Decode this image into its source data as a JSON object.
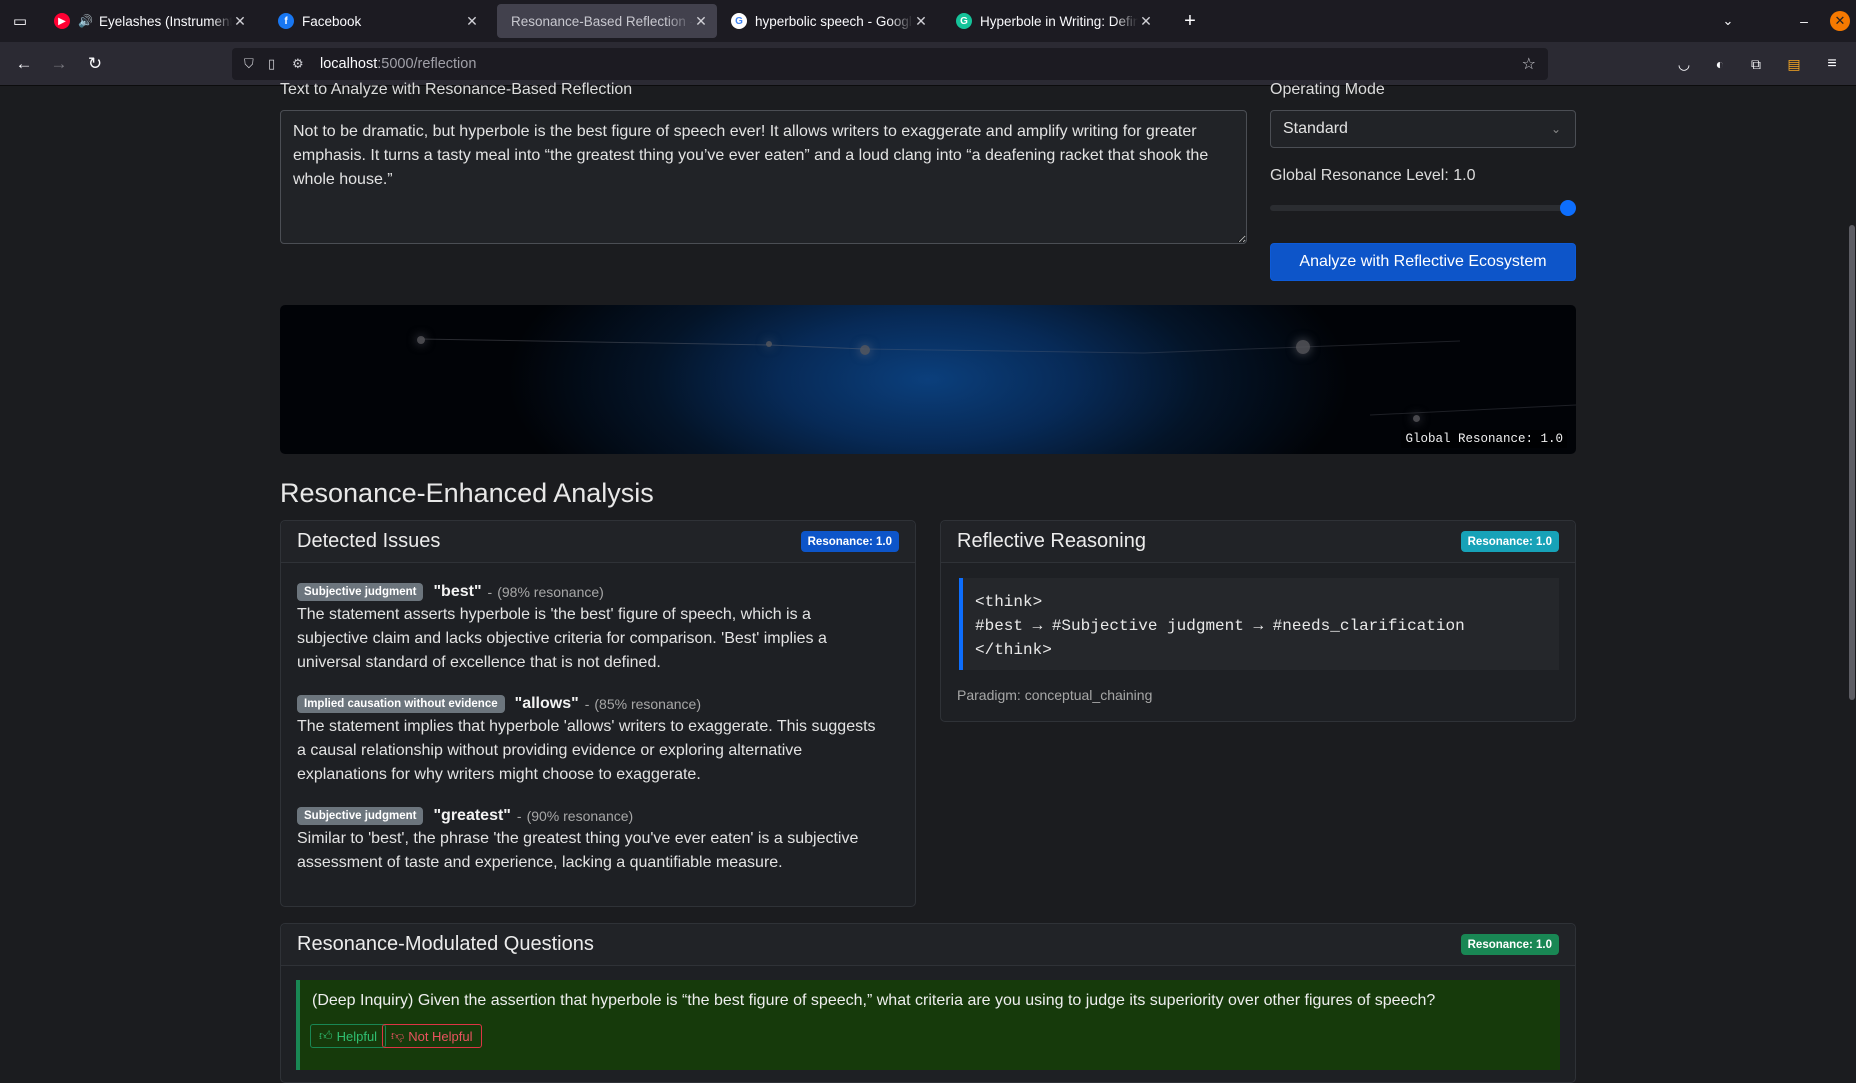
{
  "browser": {
    "tabs": [
      {
        "title": "Eyelashes (Instrumental) - A",
        "favicon": "youtube-music-icon",
        "audio": true,
        "active": false
      },
      {
        "title": "Facebook",
        "favicon": "facebook-icon",
        "active": false
      },
      {
        "title": "Resonance-Based Reflection - A",
        "favicon": "",
        "active": true
      },
      {
        "title": "hyperbolic speech - Google Se",
        "favicon": "google-icon",
        "active": false
      },
      {
        "title": "Hyperbole in Writing: Definitio",
        "favicon": "grammarly-icon",
        "active": false
      }
    ],
    "url_host": "localhost",
    "url_rest": ":5000/reflection"
  },
  "form": {
    "text_label": "Text to Analyze with Resonance-Based Reflection",
    "text_value": "Not to be dramatic, but hyperbole is the best figure of speech ever! It allows writers to exaggerate and amplify writing for greater emphasis. It turns a tasty meal into “the greatest thing you’ve ever eaten” and a loud clang into “a deafening racket that shook the whole house.”",
    "mode_label": "Operating Mode",
    "mode_value": "Standard",
    "resonance_label": "Global Resonance Level: 1.0",
    "resonance_level": 1.0,
    "analyze_button": "Analyze with Reflective Ecosystem"
  },
  "visualization": {
    "label": "Global Resonance: 1.0"
  },
  "analysis": {
    "heading": "Resonance-Enhanced Analysis",
    "issues": {
      "title": "Detected Issues",
      "badge": "Resonance: 1.0",
      "badge_color": "#0d55c9",
      "items": [
        {
          "category": "Subjective judgment",
          "term": "\"best\"",
          "sep": "-",
          "resonance": "(98% resonance)",
          "text": "The statement asserts hyperbole is 'the best' figure of speech, which is a subjective claim and lacks objective criteria for comparison. 'Best' implies a universal standard of excellence that is not defined."
        },
        {
          "category": "Implied causation without evidence",
          "term": "\"allows\"",
          "sep": "-",
          "resonance": "(85% resonance)",
          "text": "The statement implies that hyperbole 'allows' writers to exaggerate. This suggests a causal relationship without providing evidence or exploring alternative explanations for why writers might choose to exaggerate."
        },
        {
          "category": "Subjective judgment",
          "term": "\"greatest\"",
          "sep": "-",
          "resonance": "(90% resonance)",
          "text": "Similar to 'best', the phrase 'the greatest thing you've ever eaten' is a subjective assessment of taste and experience, lacking a quantifiable measure."
        }
      ]
    },
    "reasoning": {
      "title": "Reflective Reasoning",
      "badge": "Resonance: 1.0",
      "badge_color": "#17a2b8",
      "code_lines": [
        "<think>",
        "#best → #Subjective judgment → #needs_clarification",
        "</think>"
      ],
      "paradigm": "Paradigm: conceptual_chaining"
    },
    "questions": {
      "title": "Resonance-Modulated Questions",
      "badge": "Resonance: 1.0",
      "badge_color": "#198754",
      "items": [
        {
          "text": "(Deep Inquiry) Given the assertion that hyperbole is “the best figure of speech,” what criteria are you using to judge its superiority over other figures of speech?",
          "helpful": "Helpful",
          "not_helpful": "Not Helpful"
        }
      ]
    }
  }
}
